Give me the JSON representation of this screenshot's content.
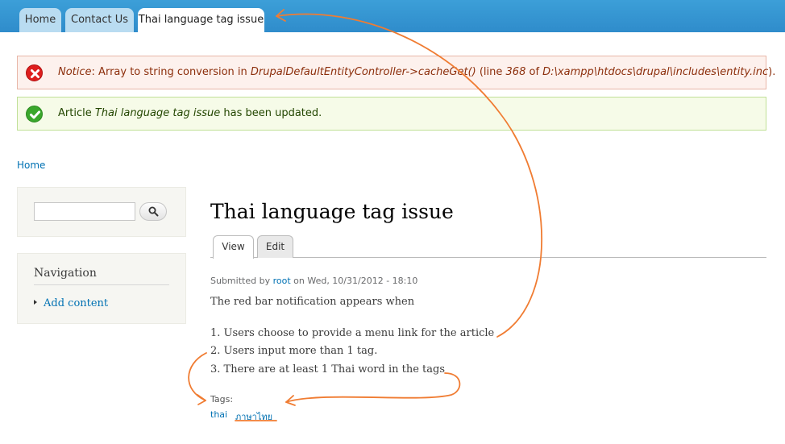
{
  "header": {
    "tabs": [
      {
        "label": "Home"
      },
      {
        "label": "Contact Us"
      },
      {
        "label": "Thai language tag issue"
      }
    ]
  },
  "messages": {
    "error": {
      "prefix": "Notice",
      "text1": ": Array to string conversion in ",
      "method": "DrupalDefaultEntityController->cacheGet()",
      "text2": " (line ",
      "line": "368",
      "text3": " of ",
      "path": "D:\\xampp\\htdocs\\drupal\\includes\\entity.inc",
      "text4": ")."
    },
    "status": {
      "text1": "Article ",
      "title": "Thai language tag issue",
      "text2": " has been updated."
    }
  },
  "breadcrumb": "Home",
  "sidebar": {
    "search": {
      "value": "",
      "placeholder": ""
    },
    "navigation": {
      "title": "Navigation",
      "items": [
        {
          "label": "Add content"
        }
      ]
    }
  },
  "main": {
    "title": "Thai language tag issue",
    "tabs": [
      {
        "label": "View"
      },
      {
        "label": "Edit"
      }
    ],
    "submitted": {
      "prefix": "Submitted by ",
      "author": "root",
      "date": " on Wed, 10/31/2012 - 18:10"
    },
    "body": [
      "The red bar notification appears when",
      "1. Users choose to provide a menu link for the article",
      "2. Users input more than 1 tag.",
      "3. There are at least 1 Thai word in the tags"
    ],
    "tags_label": "Tags:",
    "tags": [
      "thai",
      "ภาษาไทย"
    ]
  },
  "colors": {
    "annotation": "#f07c32",
    "link": "#0071b3",
    "header": "#3c9fd8"
  }
}
